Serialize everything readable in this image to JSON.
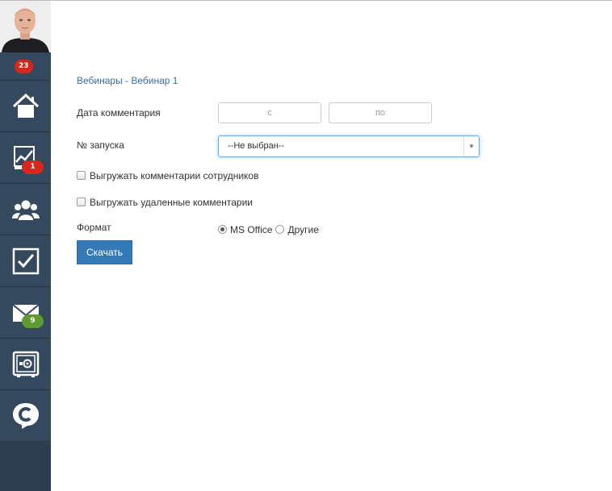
{
  "sidebar": {
    "notifications_badge": "23",
    "items": [
      {
        "icon": "home-icon"
      },
      {
        "icon": "chart-icon",
        "badge": "1"
      },
      {
        "icon": "users-icon"
      },
      {
        "icon": "checkbox-icon"
      },
      {
        "icon": "mail-icon",
        "badge": "9"
      },
      {
        "icon": "safe-icon"
      },
      {
        "icon": "chat-c-icon"
      }
    ]
  },
  "breadcrumb": {
    "text": "Вебинары -  Вебинар 1"
  },
  "form": {
    "date_label": "Дата комментария",
    "date_from_placeholder": "с",
    "date_to_placeholder": "по",
    "launch_label": "№ запуска",
    "launch_selected": "--Не выбран--",
    "export_employees_label": "Выгружать комментарии сотрудников",
    "export_deleted_label": "Выгружать удаленные комментарии",
    "format_label": "Формат",
    "format_options": [
      {
        "label": "MS Office",
        "checked": true
      },
      {
        "label": "Другие",
        "checked": false
      }
    ],
    "download_button": "Скачать"
  },
  "colors": {
    "sidebar_bg": "#34495e",
    "link": "#3a6ea5",
    "primary_button": "#337ab7",
    "badge_red": "#d9261c",
    "badge_green": "#5e9a2e"
  }
}
